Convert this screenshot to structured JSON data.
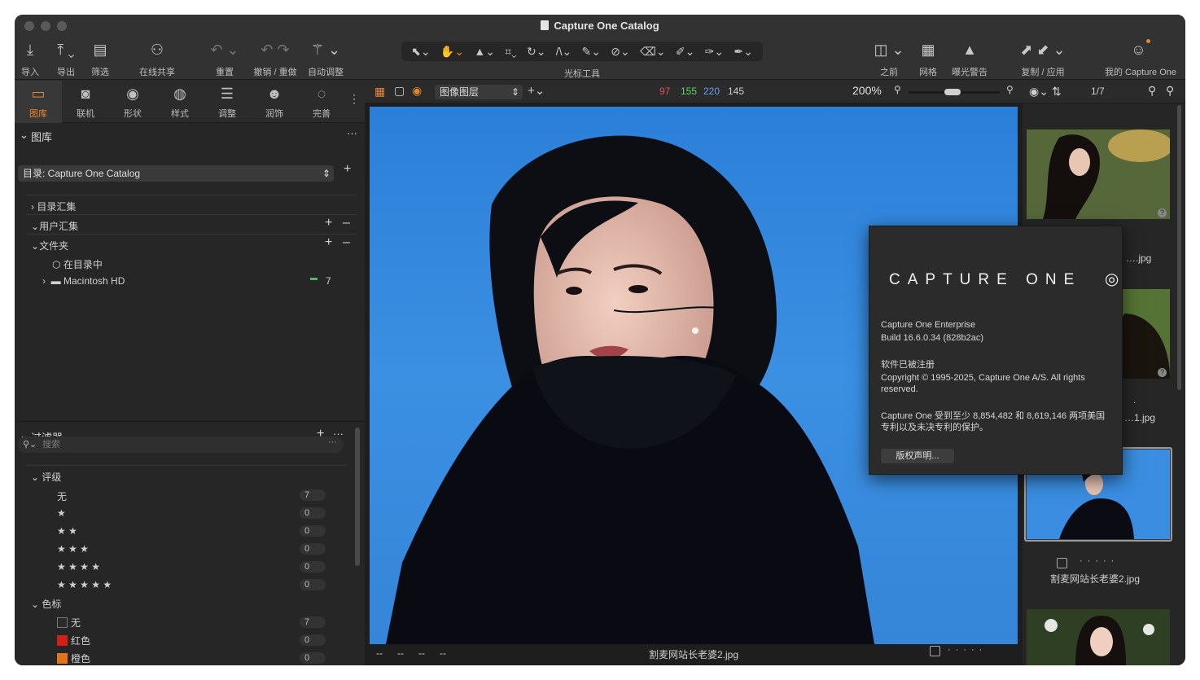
{
  "window": {
    "title": "Capture One Catalog"
  },
  "toolbar": {
    "import": "导入",
    "export": "导出",
    "filter": "筛选",
    "share": "在线共享",
    "reset": "重置",
    "undo_redo": "撤销 / 重做",
    "auto_adjust": "自动调整",
    "cursor_tools": "光标工具",
    "before": "之前",
    "grid": "网格",
    "exposure_warning": "曝光警告",
    "copy_apply": "复制 / 应用",
    "my_capture_one": "我的 Capture One"
  },
  "tooltabs": [
    {
      "label": "图库",
      "icon": "folder-icon"
    },
    {
      "label": "联机",
      "icon": "camera-icon"
    },
    {
      "label": "形状",
      "icon": "lens-icon"
    },
    {
      "label": "样式",
      "icon": "style-icon"
    },
    {
      "label": "调整",
      "icon": "sliders-icon"
    },
    {
      "label": "润饰",
      "icon": "retouch-icon"
    },
    {
      "label": "完善",
      "icon": "refine-icon"
    }
  ],
  "library": {
    "header": "图库",
    "catalog_select": "目录: Capture One Catalog",
    "catalog_collections": "目录汇集",
    "user_collections": "用户汇集",
    "folders": "文件夹",
    "in_catalog": "在目录中",
    "volume": "Macintosh HD",
    "volume_count": "7"
  },
  "filters": {
    "header": "过滤器",
    "search_placeholder": "搜索",
    "rating_header": "评级",
    "ratings": [
      {
        "label": "无",
        "count": "7"
      },
      {
        "label": "★",
        "count": "0"
      },
      {
        "label": "★ ★",
        "count": "0"
      },
      {
        "label": "★ ★ ★",
        "count": "0"
      },
      {
        "label": "★ ★ ★ ★",
        "count": "0"
      },
      {
        "label": "★ ★ ★ ★ ★",
        "count": "0"
      }
    ],
    "color_header": "色标",
    "colors": [
      {
        "label": "无",
        "count": "7",
        "color": "#2b2b2b"
      },
      {
        "label": "红色",
        "count": "0",
        "color": "#d0201a"
      },
      {
        "label": "橙色",
        "count": "0",
        "color": "#e0741c"
      }
    ]
  },
  "viewer": {
    "layer_select": "图像图层",
    "rgb": {
      "r": "97",
      "g": "155",
      "b": "220",
      "l": "145"
    },
    "zoom": "200%",
    "bottom_placeholders": [
      "--",
      "--",
      "--",
      "--"
    ],
    "filename": "割麦网站长老婆2.jpg"
  },
  "browser": {
    "counter": "1/7",
    "thumb_names": [
      "….jpg",
      "…1.jpg",
      "割麦网站长老婆2.jpg"
    ]
  },
  "about": {
    "brand": "CAPTURE ONE",
    "product": "Capture One Enterprise",
    "build": "Build 16.6.0.34 (828b2ac)",
    "registered": "软件已被注册",
    "copyright": "Copyright © 1995-2025, Capture One A/S. All rights reserved.",
    "patents": "Capture One 受到至少 8,854,482 和 8,619,146 两项美国专利以及未决专利的保护。",
    "license_button": "版权声明..."
  },
  "colors": {
    "accent": "#e8862a",
    "r": "#e05252",
    "g": "#5fd45f",
    "b": "#6f9cf2"
  }
}
